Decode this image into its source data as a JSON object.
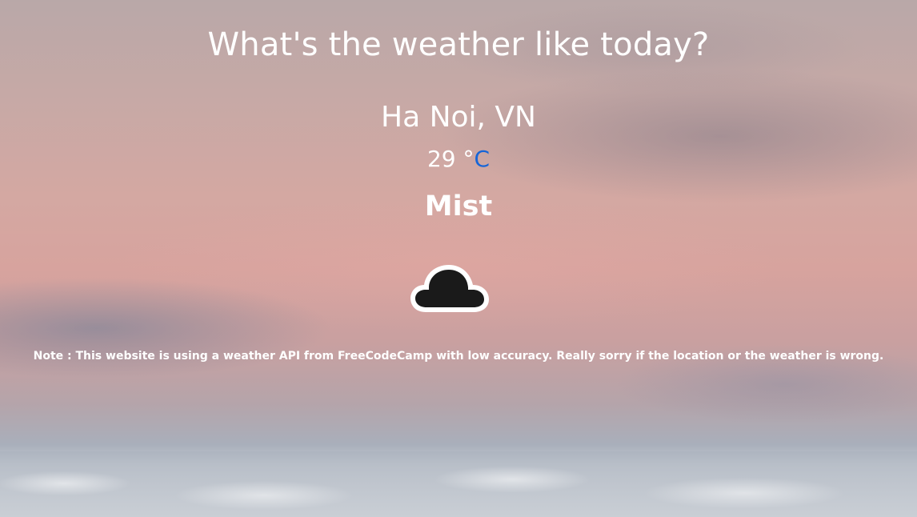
{
  "header": {
    "title": "What's the weather like today?"
  },
  "weather": {
    "location": "Ha Noi, VN",
    "temperature": "29",
    "degree_symbol": "°",
    "unit": "C",
    "condition": "Mist",
    "icon": "cloud-icon"
  },
  "footer": {
    "note": "Note : This website is using a weather API from FreeCodeCamp with low accuracy. Really sorry if the location or the weather is wrong."
  },
  "colors": {
    "text": "#ffffff",
    "unit_link": "#1565d8",
    "icon_fill": "#1a1a1a"
  }
}
